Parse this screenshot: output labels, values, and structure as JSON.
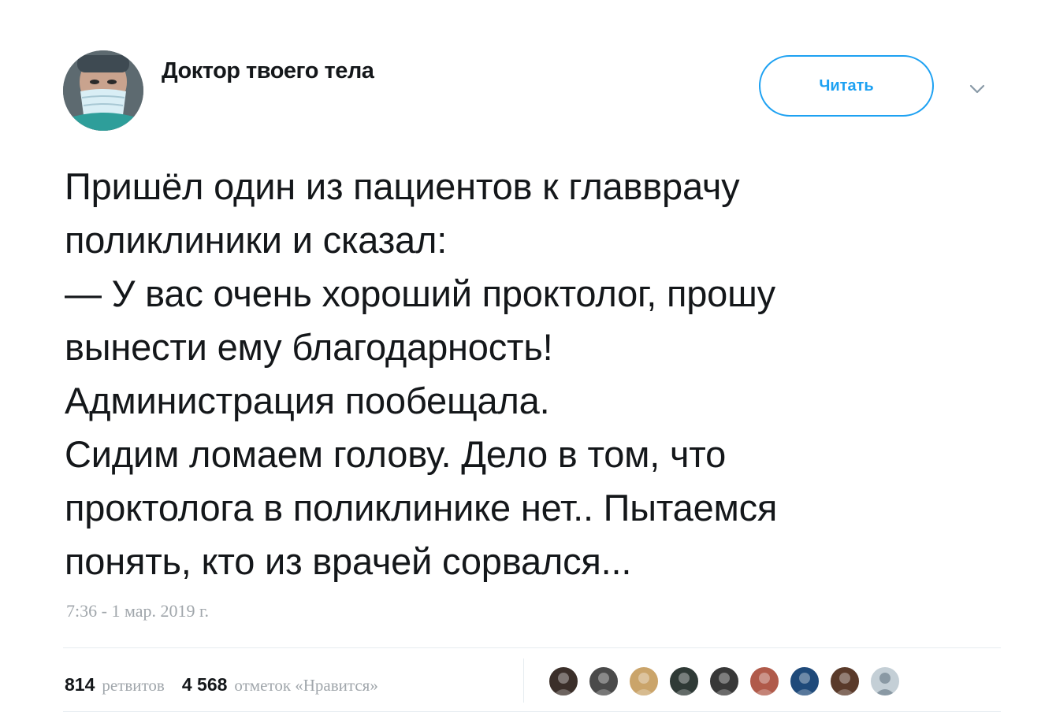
{
  "author": {
    "name": "Доктор твоего тела",
    "avatar_icon": "doctor-avatar"
  },
  "follow_button": {
    "label": "Читать"
  },
  "menu_icon": "chevron-down-icon",
  "tweet": {
    "lines": [
      "Пришёл один из пациентов к главврачу",
      "поликлиники и сказал:",
      "— У вас очень хороший проктолог, прошу",
      "вынести ему благодарность!",
      "Администрация пообещала.",
      "Сидим ломаем голову. Дело в том, что",
      "проктолога в поликлинике нет.. Пытаемся",
      "понять, кто из врачей сорвался..."
    ],
    "timestamp": "7:36 - 1 мар. 2019 г."
  },
  "stats": {
    "retweets_count": "814",
    "retweets_label": "ретвитов",
    "likes_count": "4 568",
    "likes_label": "отметок «Нравится»"
  },
  "likers": [
    {
      "name": "liker-1",
      "color": "#3b2f2a"
    },
    {
      "name": "liker-2",
      "color": "#4a4a4a"
    },
    {
      "name": "liker-3",
      "color": "#caa46a"
    },
    {
      "name": "liker-4",
      "color": "#2f3a36"
    },
    {
      "name": "liker-5",
      "color": "#383838"
    },
    {
      "name": "liker-6",
      "color": "#b05a4a"
    },
    {
      "name": "liker-7",
      "color": "#1f4a7a"
    },
    {
      "name": "liker-8",
      "color": "#5a3a2a"
    },
    {
      "name": "liker-9",
      "color": "#c4cfd6"
    }
  ],
  "colors": {
    "accent": "#1da1f2",
    "text": "#14171a",
    "muted": "#a0a6ab",
    "divider": "#e6ecf0"
  }
}
